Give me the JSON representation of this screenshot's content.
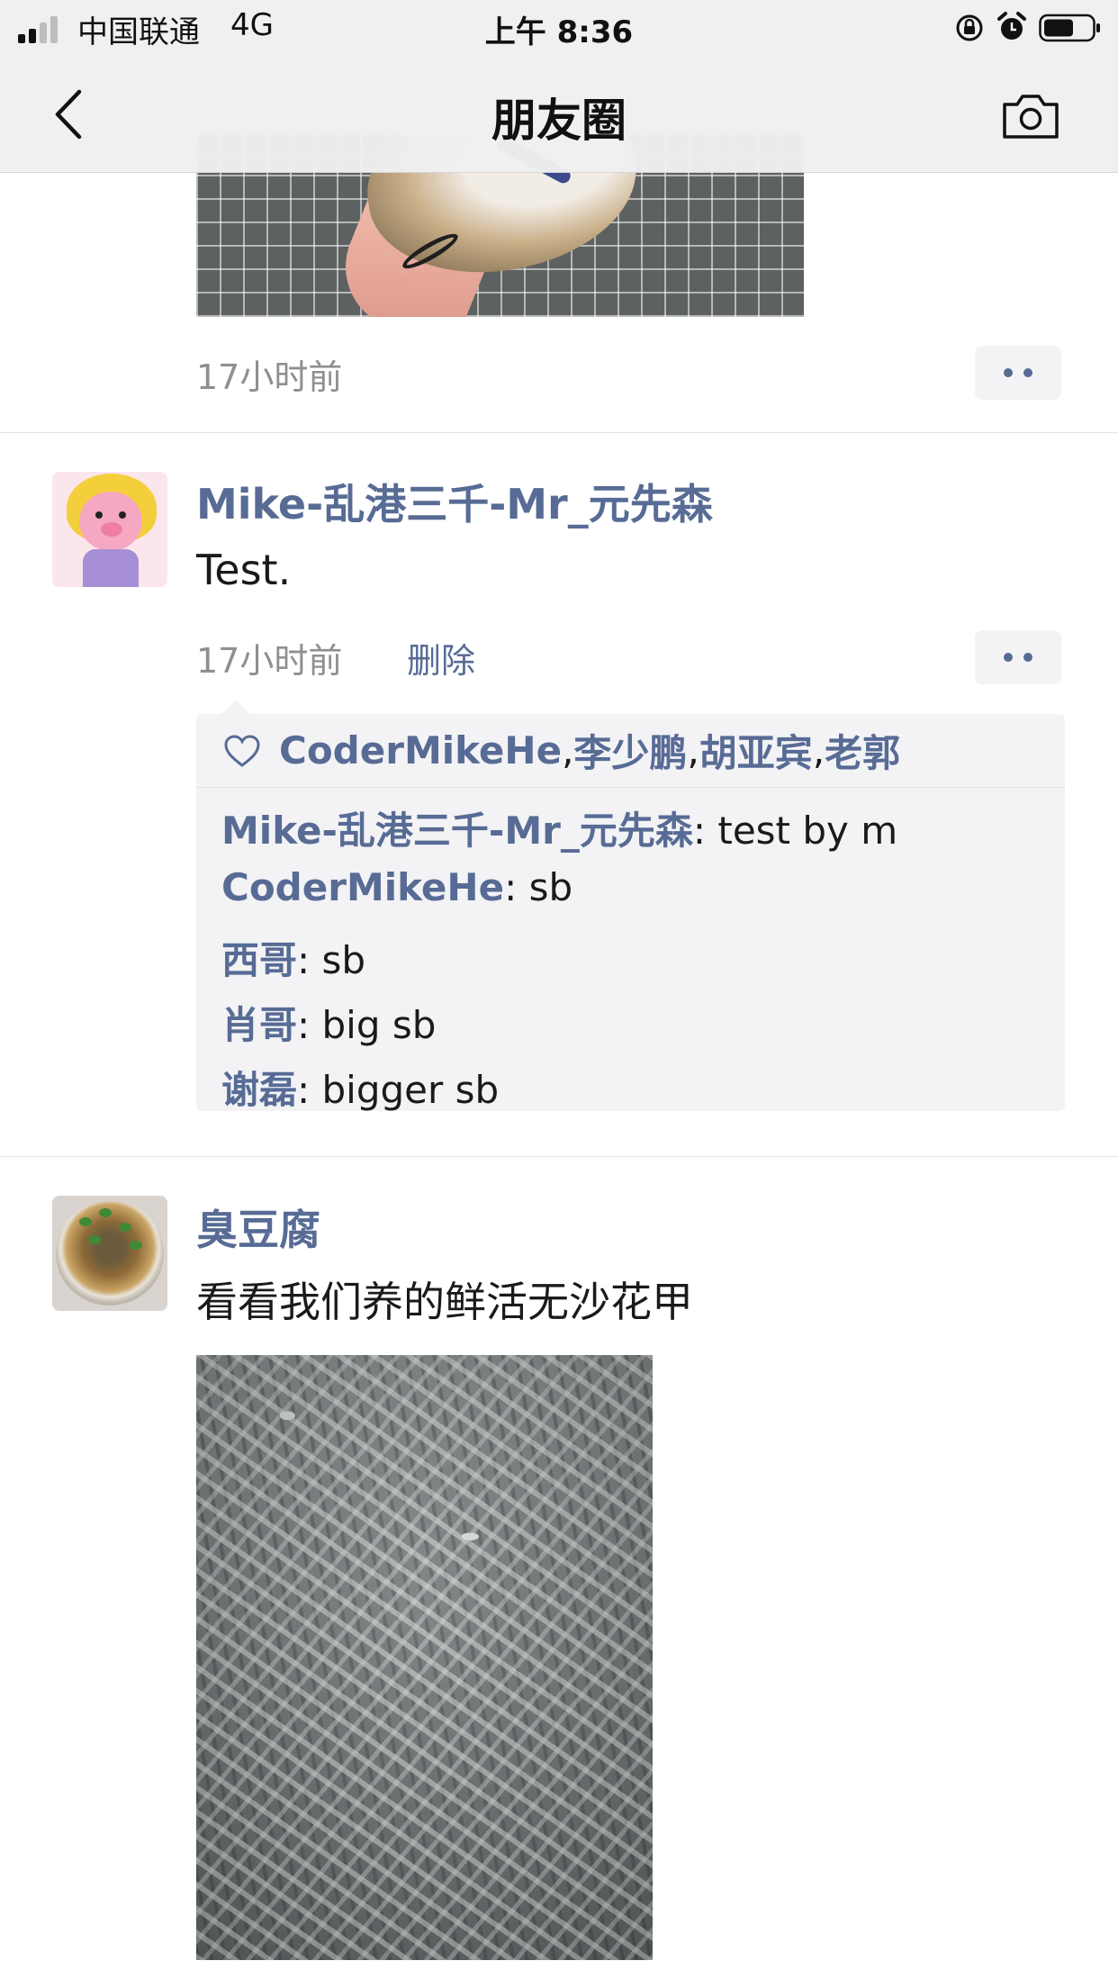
{
  "status_bar": {
    "carrier": "中国联通",
    "network": "4G",
    "time": "上午 8:36",
    "icons": [
      "signal-icon",
      "orientation-lock-icon",
      "alarm-icon",
      "battery-icon"
    ]
  },
  "nav": {
    "title": "朋友圈",
    "back_icon": "chevron-left-icon",
    "camera_icon": "camera-icon"
  },
  "colors": {
    "link": "#576b95",
    "text": "#1a1a1a",
    "muted": "#8e8e93",
    "comment_bg": "#f3f3f5"
  },
  "feed": {
    "previous_post": {
      "timestamp": "17小时前"
    },
    "post_mike": {
      "author": "Mike-乱港三千-Mr_元先森",
      "text": "Test.",
      "timestamp": "17小时前",
      "delete_label": "删除",
      "likes": [
        "CoderMikeHe",
        "李少鹏",
        "胡亚宾",
        "老郭"
      ],
      "separator": ", ",
      "comments": [
        {
          "author": "Mike-乱港三千-Mr_元先森",
          "text": ": test by m"
        },
        {
          "author": "CoderMikeHe",
          "text": ": sb"
        },
        {
          "author": "西哥",
          "text": ": sb"
        },
        {
          "author": "肖哥",
          "text": ": big sb"
        },
        {
          "author": "谢磊",
          "text": ": bigger sb"
        }
      ]
    },
    "post_tofu": {
      "author": "臭豆腐",
      "text": "看看我们养的鲜活无沙花甲"
    }
  }
}
